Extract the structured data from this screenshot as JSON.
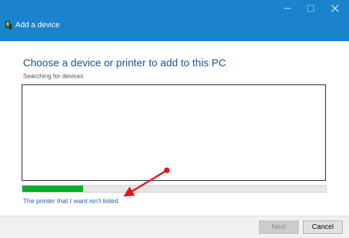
{
  "window": {
    "title": "Add a device",
    "icon": "add-device-icon",
    "controls": {
      "minimize_icon": "minimize-icon",
      "maximize_icon": "maximize-icon",
      "close_icon": "close-icon"
    }
  },
  "main": {
    "heading": "Choose a device or printer to add to this PC",
    "status": "Searching for devices",
    "progress": 0.2,
    "link": "The printer that I want isn't listed"
  },
  "annotation": {
    "arrow_color": "#e8141a"
  },
  "footer": {
    "next_label": "Next",
    "next_enabled": false,
    "cancel_label": "Cancel"
  },
  "colors": {
    "titlebar": "#1a83cc",
    "heading": "#1f4e9f",
    "link": "#1d5fb8",
    "progress_fill": "#06b025"
  }
}
